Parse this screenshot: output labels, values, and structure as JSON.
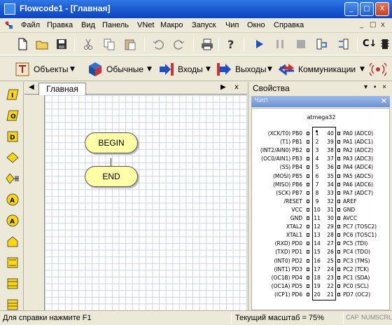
{
  "window": {
    "title": "Flowcode1 - [Главная]",
    "minimize_glyph": "_",
    "maximize_glyph": "□",
    "close_glyph": "X"
  },
  "menu": {
    "items": [
      "Файл",
      "Правка",
      "Вид",
      "Панель",
      "VNet",
      "Макро",
      "Запуск",
      "Чип",
      "Окно",
      "Справка"
    ],
    "mdi_glyphs": [
      "_",
      "□",
      "x"
    ]
  },
  "toolbar_main": {
    "icons": [
      "new-file-icon",
      "open-folder-icon",
      "save-icon",
      "cut-icon",
      "copy-icon",
      "paste-icon",
      "undo-icon",
      "redo-icon",
      "print-icon",
      "help-icon",
      "run-icon",
      "pause-icon",
      "stop-icon",
      "step-into-icon",
      "step-over-icon",
      "compile-c-icon",
      "compile-chip-icon"
    ],
    "compile_label": "C↓"
  },
  "toolbar_components": {
    "items": [
      {
        "label": "Объекты",
        "icon": "objects-icon"
      },
      {
        "label": "Обычные",
        "icon": "common-icon"
      },
      {
        "label": "Входы",
        "icon": "inputs-icon"
      },
      {
        "label": "Выходы",
        "icon": "outputs-icon"
      },
      {
        "label": "Коммуникации",
        "icon": "comms-icon"
      }
    ],
    "dropdown_glyph": "▼"
  },
  "left_tools": [
    "input-icon",
    "output-icon",
    "delay-icon",
    "decision-icon",
    "connection-point-icon",
    "calculation-icon",
    "component-macro-icon",
    "macro-icon",
    "loop-icon",
    "multiplex-icon",
    "interrupt-icon"
  ],
  "left_tool_letters": [
    "I",
    "O",
    "D",
    "",
    "",
    "A",
    "A",
    "",
    "",
    "",
    ""
  ],
  "chart": {
    "tab_label": "Главная",
    "nav_left": "◀",
    "nav_right": "▶",
    "close": "x",
    "begin_label": "BEGIN",
    "end_label": "END"
  },
  "properties": {
    "title": "Свойства",
    "header_buttons": "▾ ▪ ×",
    "chip_panel_label": "Чип",
    "chip_panel_close": "×",
    "chip_name": "atmega32",
    "left_pins": [
      {
        "name": "(XCK/T0) PB0",
        "num": "1"
      },
      {
        "name": "(T1) PB1",
        "num": "2"
      },
      {
        "name": "(INT2/AIN0) PB2",
        "num": "3"
      },
      {
        "name": "(OC0/AIN1) PB3",
        "num": "4"
      },
      {
        "name": "(SS) PB4",
        "num": "5"
      },
      {
        "name": "(MOSI) PB5",
        "num": "6"
      },
      {
        "name": "(MISO) PB6",
        "num": "7"
      },
      {
        "name": "(SCK) PB7",
        "num": "8"
      },
      {
        "name": "/RESET",
        "num": "9"
      },
      {
        "name": "VCC",
        "num": "10"
      },
      {
        "name": "GND",
        "num": "11"
      },
      {
        "name": "XTAL2",
        "num": "12"
      },
      {
        "name": "XTAL1",
        "num": "13"
      },
      {
        "name": "(RXD) PD0",
        "num": "14"
      },
      {
        "name": "(TXD) PD1",
        "num": "15"
      },
      {
        "name": "(INT0) PD2",
        "num": "16"
      },
      {
        "name": "(INT1) PD3",
        "num": "17"
      },
      {
        "name": "(OC1B) PD4",
        "num": "18"
      },
      {
        "name": "(OC1A) PD5",
        "num": "19"
      },
      {
        "name": "(ICP1) PD6",
        "num": "20"
      }
    ],
    "right_pins": [
      {
        "name": "PA0 (ADC0)",
        "num": "40"
      },
      {
        "name": "PA1 (ADC1)",
        "num": "39"
      },
      {
        "name": "PA2 (ADC2)",
        "num": "38"
      },
      {
        "name": "PA3 (ADC3)",
        "num": "37"
      },
      {
        "name": "PA4 (ADC4)",
        "num": "36"
      },
      {
        "name": "PA5 (ADC5)",
        "num": "35"
      },
      {
        "name": "PA6 (ADC6)",
        "num": "34"
      },
      {
        "name": "PA7 (ADC7)",
        "num": "33"
      },
      {
        "name": "AREF",
        "num": "32"
      },
      {
        "name": "GND",
        "num": "31"
      },
      {
        "name": "AVCC",
        "num": "30"
      },
      {
        "name": "PC7 (TOSC2)",
        "num": "29"
      },
      {
        "name": "PC6 (TOSC1)",
        "num": "28"
      },
      {
        "name": "PC5 (TDI)",
        "num": "27"
      },
      {
        "name": "PC4 (TDO)",
        "num": "26"
      },
      {
        "name": "PC3 (TMS)",
        "num": "25"
      },
      {
        "name": "PC2 (TCK)",
        "num": "24"
      },
      {
        "name": "PC1 (SDA)",
        "num": "23"
      },
      {
        "name": "PC0 (SCL)",
        "num": "22"
      },
      {
        "name": "PD7 (OC2)",
        "num": "21"
      }
    ]
  },
  "status": {
    "help_text": "Для справки нажмите F1",
    "zoom_text": "Текущий масштаб = 75%",
    "indicators": [
      "CAP",
      "NUM",
      "SCRL"
    ]
  },
  "colors": {
    "title_blue": "#0a46c4",
    "terminal_fill": "#ffffa8",
    "grid_line": "#c8d3e6",
    "chip_bar": "#6b93d8"
  }
}
